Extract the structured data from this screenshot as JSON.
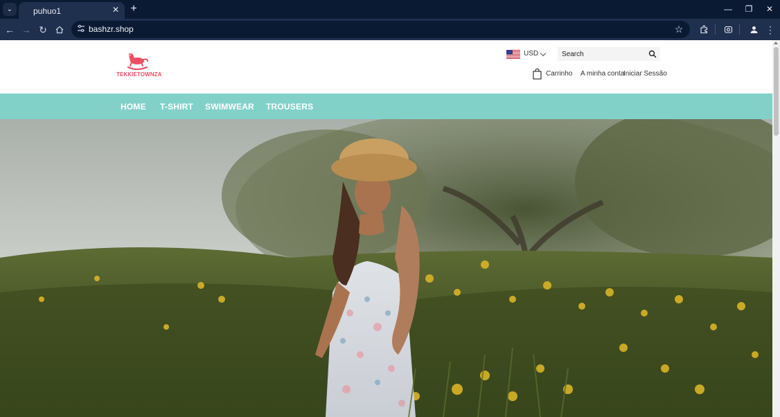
{
  "browser": {
    "tab_title": "puhuo1",
    "url": "bashzr.shop"
  },
  "store": {
    "logo_text": "TEKKIETOWNZA",
    "currency": "USD",
    "search_placeholder": "Search",
    "cart_label": "Carrinho",
    "account_label": "A minha conta",
    "login_label": "Iniciar Sessão"
  },
  "nav": {
    "items": [
      {
        "label": "HOME"
      },
      {
        "label": "T-SHIRT"
      },
      {
        "label": "SWIMWEAR"
      },
      {
        "label": "TROUSERS"
      }
    ]
  },
  "colors": {
    "nav_bg": "#82d1c9",
    "brand": "#ec4f63",
    "chrome_dark": "#0b1a33",
    "chrome_toolbar": "#1f2f4e"
  },
  "icons": {
    "tab_menu": "chevron-down-icon",
    "back": "arrow-left-icon",
    "forward": "arrow-right-icon",
    "reload": "reload-icon",
    "home": "home-icon",
    "site_info": "tune-icon",
    "bookmark": "star-icon",
    "extensions": "puzzle-icon",
    "profile": "person-icon",
    "menu": "kebab-icon",
    "cart": "shopping-bag-icon",
    "search": "search-icon"
  }
}
